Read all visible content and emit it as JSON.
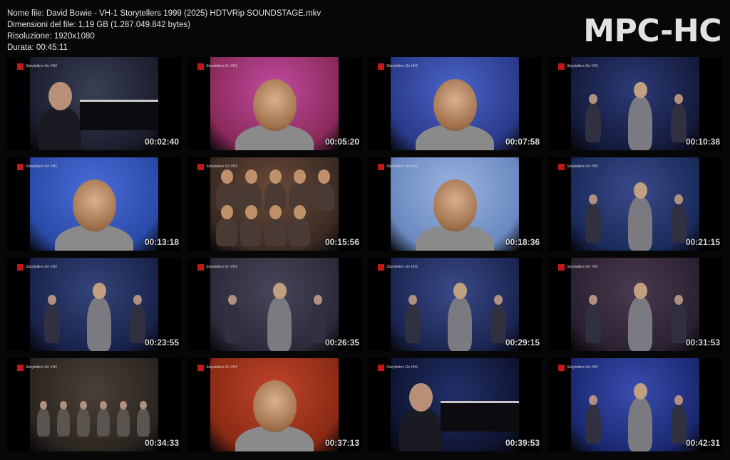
{
  "file_info": {
    "name_line": "Nome file: David Bowie - VH-1 Storytellers 1999 (2025) HDTVRip SOUNDSTAGE.mkv",
    "size_line": "Dimensioni del file: 1,19 GB (1.287.049.842 bytes)",
    "resolution_line": "Risoluzione: 1920x1080",
    "duration_line": "Durata: 00:45:11"
  },
  "brand": "MPC-HC",
  "thumbnails": [
    {
      "time": "00:02:40",
      "scene": "piano",
      "colors": [
        "#1a1d2c",
        "#3a3f55"
      ]
    },
    {
      "time": "00:05:20",
      "scene": "closeup",
      "colors": [
        "#8a2a5a",
        "#c04aa0"
      ]
    },
    {
      "time": "00:07:58",
      "scene": "closeup",
      "colors": [
        "#2a3a8a",
        "#4a64c8"
      ]
    },
    {
      "time": "00:10:38",
      "scene": "band",
      "colors": [
        "#141a3a",
        "#2c3a78"
      ]
    },
    {
      "time": "00:13:18",
      "scene": "closeup",
      "colors": [
        "#2a4aa8",
        "#4a6cd8"
      ]
    },
    {
      "time": "00:15:56",
      "scene": "audience",
      "colors": [
        "#3a2a22",
        "#6a4a3a"
      ]
    },
    {
      "time": "00:18:36",
      "scene": "closeup",
      "colors": [
        "#6a88c0",
        "#9ab4e0"
      ]
    },
    {
      "time": "00:21:15",
      "scene": "band",
      "colors": [
        "#1a2a5a",
        "#3a4a8a"
      ]
    },
    {
      "time": "00:23:55",
      "scene": "band",
      "colors": [
        "#18224a",
        "#34447a"
      ]
    },
    {
      "time": "00:26:35",
      "scene": "stage",
      "colors": [
        "#2a2a3a",
        "#4a4458"
      ]
    },
    {
      "time": "00:29:15",
      "scene": "band",
      "colors": [
        "#1a2450",
        "#3a4a88"
      ]
    },
    {
      "time": "00:31:53",
      "scene": "band",
      "colors": [
        "#2a2030",
        "#4a3a50"
      ]
    },
    {
      "time": "00:34:33",
      "scene": "wide",
      "colors": [
        "#2a2420",
        "#4a4036"
      ]
    },
    {
      "time": "00:37:13",
      "scene": "closeup",
      "colors": [
        "#8a2a14",
        "#c0442a"
      ]
    },
    {
      "time": "00:39:53",
      "scene": "piano",
      "colors": [
        "#0e1430",
        "#22306a"
      ]
    },
    {
      "time": "00:42:31",
      "scene": "band",
      "colors": [
        "#1a2870",
        "#3a4cb0"
      ]
    }
  ],
  "overlay_logo_text": "Storytellers  On VH1"
}
